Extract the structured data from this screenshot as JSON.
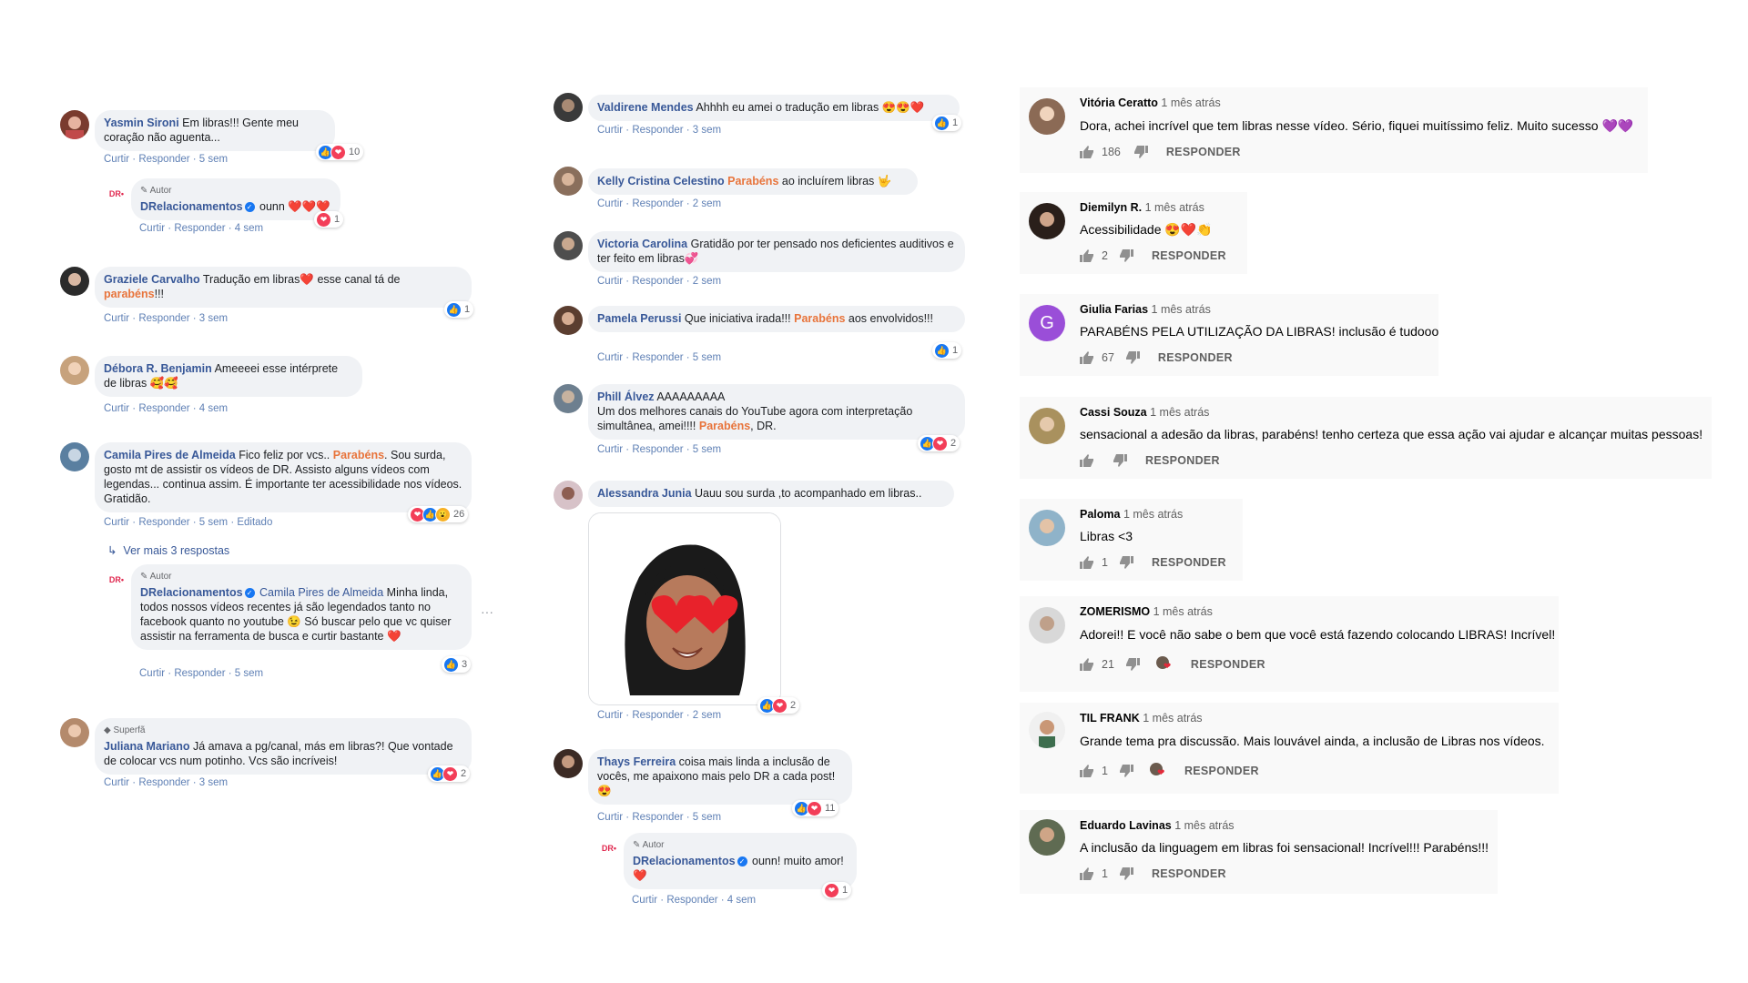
{
  "fb_left": [
    {
      "name": "Yasmin Sironi",
      "text": "Em libras!!! Gente meu coração não aguenta...",
      "actions": "Curtir · Responder · 5 sem",
      "reactions": "10",
      "reply": {
        "badge": "Autor",
        "name": "DRelacionamentos",
        "text": "ounn ❤️❤️❤️",
        "actions": "Curtir · Responder · 4 sem",
        "reactions": "1"
      }
    },
    {
      "name": "Graziele Carvalho",
      "text_a": "Tradução em libras",
      "text_b": "esse canal tá de",
      "hl": "parabéns",
      "text_c": "!!!",
      "actions": "Curtir · Responder · 3 sem",
      "reactions": "1"
    },
    {
      "name": "Débora R. Benjamin",
      "text": "Ameeeei esse intérprete de libras 🥰🥰",
      "actions": "Curtir · Responder · 4 sem"
    },
    {
      "name": "Camila Pires de Almeida",
      "text_a": "Fico feliz por vcs..",
      "hl": "Parabéns",
      "text_b": ". Sou surda, gosto mt de assistir os vídeos de DR. Assisto alguns vídeos com legendas... continua assim. É importante ter acessibilidade nos vídeos. Gratidão.",
      "actions": "Curtir · Responder · 5 sem · Editado",
      "reactions": "26",
      "more": "Ver mais 3 respostas",
      "reply": {
        "badge": "Autor",
        "name": "DRelacionamentos",
        "mention": "Camila Pires de Almeida",
        "text": "Minha linda, todos nossos vídeos recentes já são legendados tanto no facebook quanto no youtube 😉 Só buscar pelo que vc quiser assistir na ferramenta de busca e curtir bastante ❤️",
        "actions": "Curtir · Responder · 5 sem",
        "reactions": "3"
      }
    },
    {
      "badge": "Superfã",
      "name": "Juliana Mariano",
      "text": "Já amava a pg/canal, más em libras?! Que vontade de colocar vcs num potinho. Vcs são incríveis!",
      "actions": "Curtir · Responder · 3 sem",
      "reactions": "2"
    }
  ],
  "fb_mid": [
    {
      "name": "Valdirene Mendes",
      "text": "Ahhhh eu amei o tradução em libras 😍😍❤️",
      "actions": "Curtir · Responder · 3 sem",
      "reactions": "1"
    },
    {
      "name": "Kelly Cristina Celestino",
      "hl": "Parabéns",
      "text": "ao incluírem libras 🤟",
      "actions": "Curtir · Responder · 2 sem"
    },
    {
      "name": "Victoria Carolina",
      "text": "Gratidão por ter pensado nos deficientes auditivos e ter feito em libras💞",
      "actions": "Curtir · Responder · 2 sem"
    },
    {
      "name": "Pamela Perussi",
      "text_a": "Que iniciativa irada!!!",
      "hl": "Parabéns",
      "text_b": "aos envolvidos!!!",
      "actions": "Curtir · Responder · 5 sem",
      "reactions": "1"
    },
    {
      "name": "Phill Álvez",
      "text_a": "AAAAAAAAA",
      "text_b": "Um dos melhores canais do YouTube agora com interpretação simultânea, amei!!!!",
      "hl": "Parabéns",
      "text_c": ", DR.",
      "actions": "Curtir · Responder · 5 sem",
      "reactions": "2"
    },
    {
      "name": "Alessandra Junia",
      "text": "Uauu sou surda ,to acompanhado em libras..",
      "actions": "Curtir · Responder · 2 sem",
      "reactions": "2"
    },
    {
      "name": "Thays Ferreira",
      "text": "coisa mais linda a inclusão de vocês, me apaixono mais pelo DR a cada post! 😍",
      "actions": "Curtir · Responder · 5 sem",
      "reactions": "11",
      "reply": {
        "badge": "Autor",
        "name": "DRelacionamentos",
        "text": "ounn! muito amor! ❤️",
        "actions": "Curtir · Responder · 4 sem",
        "reactions": "1"
      }
    }
  ],
  "yt": [
    {
      "name": "Vitória Ceratto",
      "time": "1 mês atrás",
      "text": "Dora, achei incrível que tem libras nesse vídeo. Sério, fiquei muitíssimo feliz. Muito sucesso 💜💜",
      "likes": "186",
      "reply": "RESPONDER"
    },
    {
      "name": "Diemilyn R.",
      "time": "1 mês atrás",
      "text": "Acessibilidade 😍❤️👏",
      "likes": "2",
      "reply": "RESPONDER"
    },
    {
      "name": "Giulia Farias",
      "time": "1 mês atrás",
      "text": "PARABÉNS PELA UTILIZAÇÃO DA LIBRAS! inclusão é tudooo",
      "likes": "67",
      "reply": "RESPONDER",
      "initial": "G"
    },
    {
      "name": "Cassi Souza",
      "time": "1 mês atrás",
      "text": "sensacional a adesão da libras, parabéns! tenho certeza que essa ação vai ajudar e alcançar muitas pessoas!",
      "likes": "",
      "reply": "RESPONDER"
    },
    {
      "name": "Paloma",
      "time": "1 mês atrás",
      "text": "Libras <3",
      "likes": "1",
      "reply": "RESPONDER"
    },
    {
      "name": "ZOMERISMO",
      "time": "1 mês atrás",
      "text": "Adorei!! E você não sabe o bem que você está fazendo colocando LIBRAS! Incrível!",
      "likes": "21",
      "reply": "RESPONDER"
    },
    {
      "name": "TIL FRANK",
      "time": "1 mês atrás",
      "text": "Grande tema pra discussão. Mais louvável ainda, a inclusão de Libras nos vídeos.",
      "likes": "1",
      "reply": "RESPONDER"
    },
    {
      "name": "Eduardo Lavinas",
      "time": "1 mês atrás",
      "text": "A inclusão da linguagem em libras foi sensacional! Incrível!!! Parabéns!!!",
      "likes": "1",
      "reply": "RESPONDER"
    }
  ],
  "colors": {
    "fb_name": "#385898",
    "fb_highlight": "#e8743b",
    "fb_bubble": "#f0f2f5",
    "yt_bg": "#f9f9f9",
    "like": "#1877f2",
    "love": "#f33e58"
  }
}
